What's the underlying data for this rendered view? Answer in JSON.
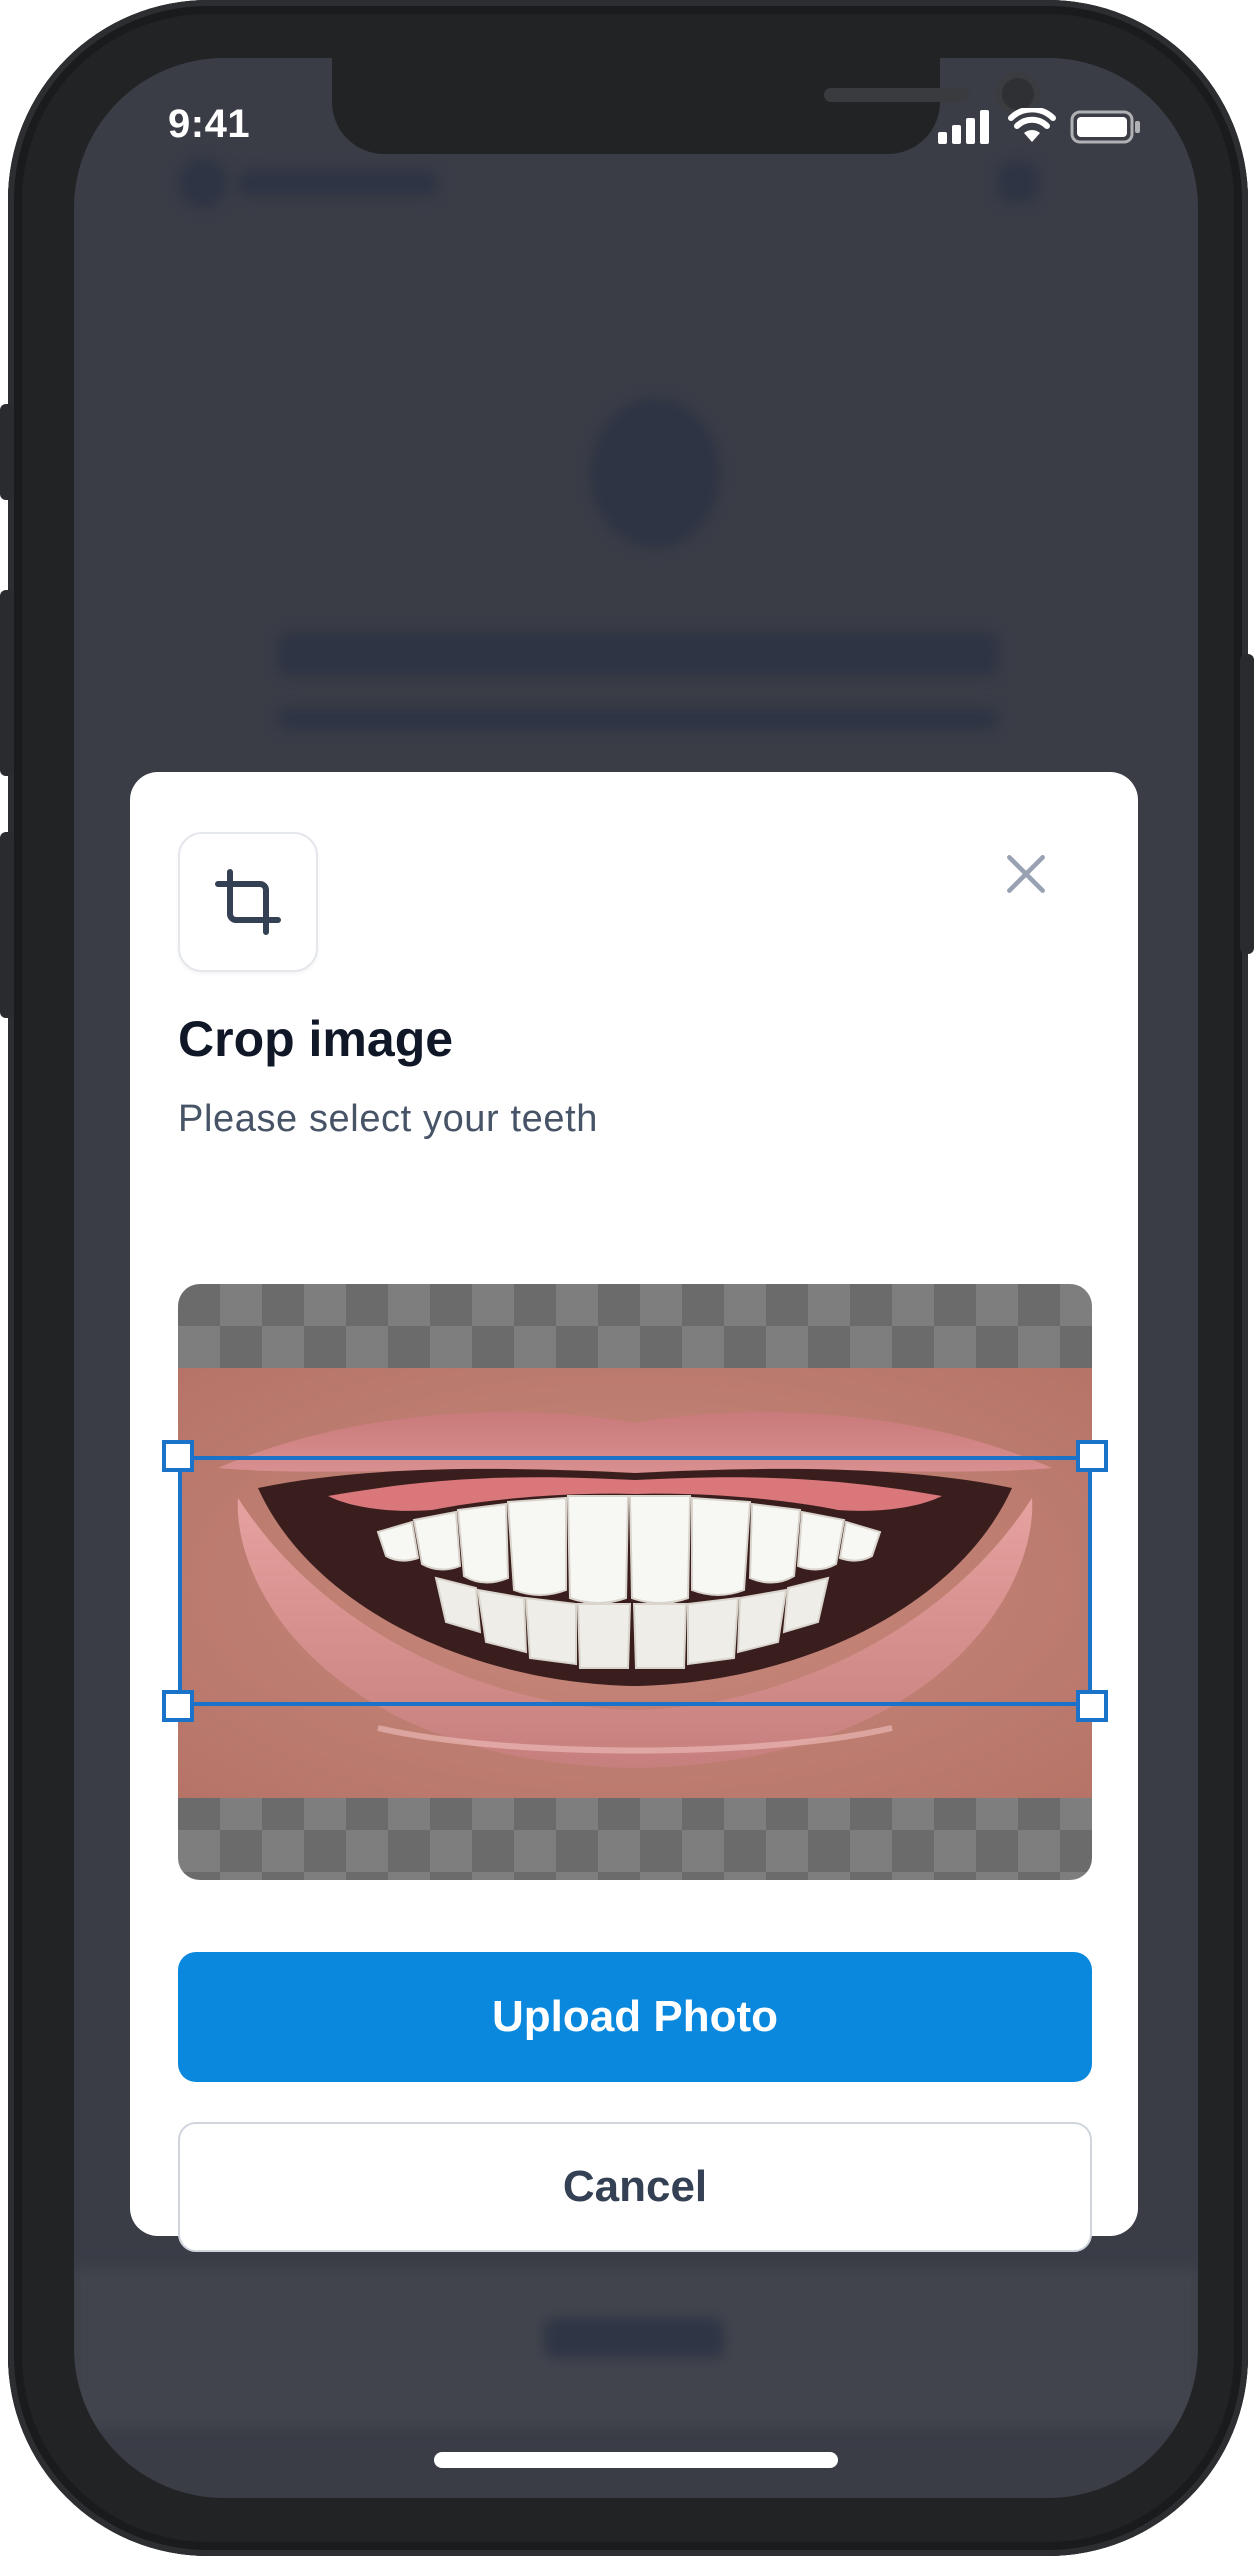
{
  "status_bar": {
    "time": "9:41",
    "icons": [
      "cellular-signal-icon",
      "wifi-icon",
      "battery-icon"
    ]
  },
  "modal": {
    "icon": "crop-icon",
    "close_icon": "close-icon",
    "title": "Crop image",
    "subtitle": "Please select your teeth",
    "image_subject": "smiling mouth with teeth",
    "primary_button_label": "Upload Photo",
    "secondary_button_label": "Cancel"
  },
  "colors": {
    "primary": "#0a88dd",
    "crop_frame": "#1a73c8",
    "title_text": "#101828",
    "subtitle_text": "#475467",
    "overlay_background": "#3a3d46"
  }
}
